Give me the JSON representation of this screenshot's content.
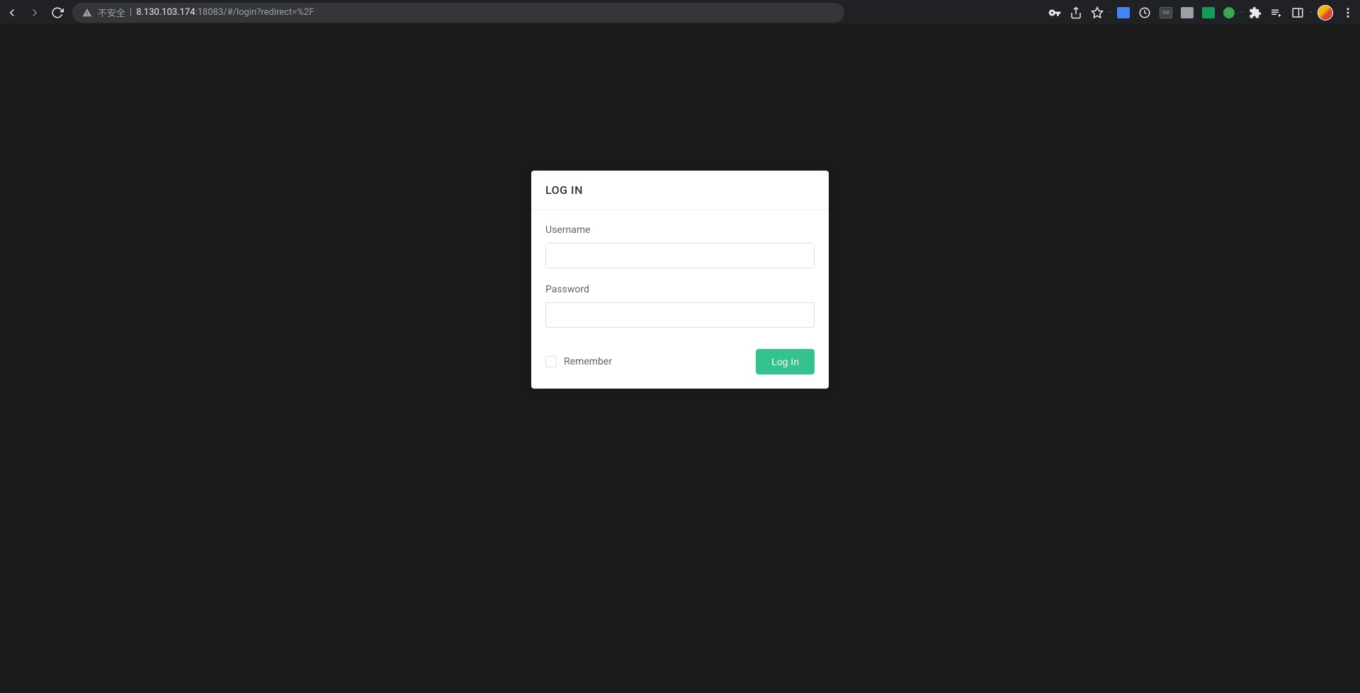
{
  "browser": {
    "insecure_label": "不安全",
    "url_host": "8.130.103.174",
    "url_path": ":18083/#/login?redirect=%2F"
  },
  "login": {
    "title": "LOG IN",
    "username_label": "Username",
    "username_value": "",
    "password_label": "Password",
    "password_value": "",
    "remember_label": "Remember",
    "submit_label": "Log In"
  }
}
